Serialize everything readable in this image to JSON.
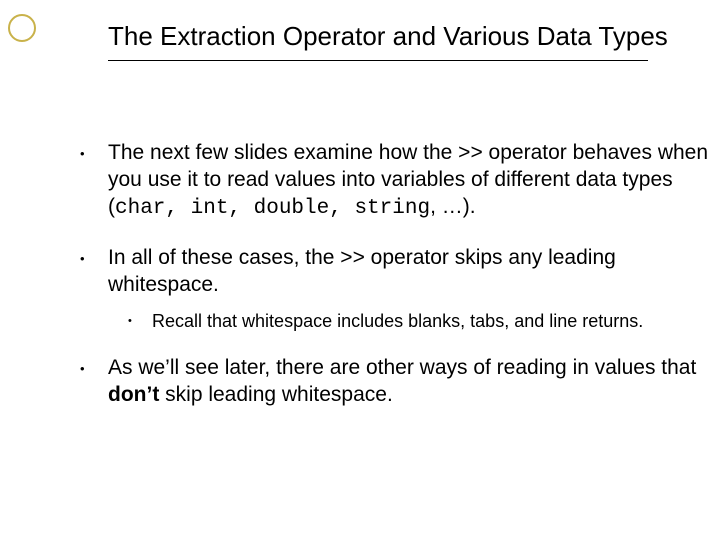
{
  "title": "The Extraction Operator and Various Data Types",
  "bullets": {
    "b1_pre": "The next few slides examine how the >> operator behaves when you use it to read values into variables of different data types (",
    "b1_code": "char, int, double, string",
    "b1_post": ", …).",
    "b2": "In all of these cases, the >> operator skips any leading whitespace.",
    "b2_sub": "Recall that whitespace includes blanks, tabs, and line returns.",
    "b3_pre": "As we’ll see later, there are other ways of reading in values that ",
    "b3_bold": "don’t",
    "b3_post": " skip leading whitespace."
  }
}
